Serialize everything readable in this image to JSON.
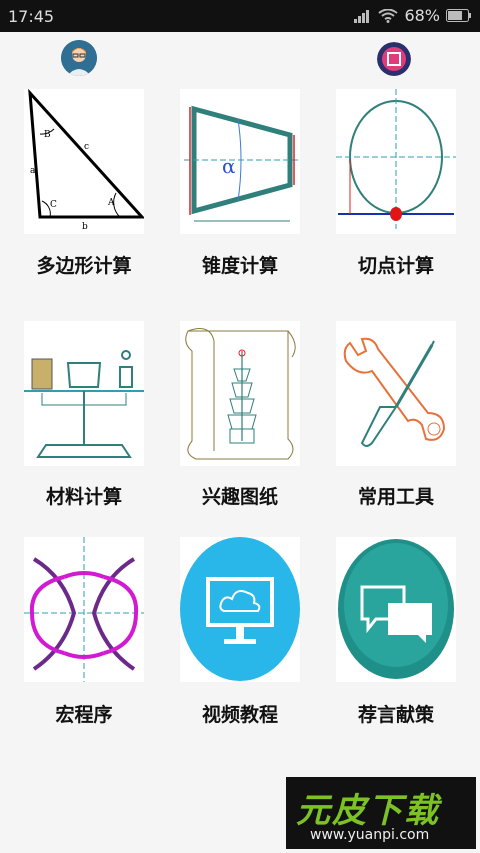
{
  "status": {
    "time": "17:45",
    "battery": "68%"
  },
  "avatars": {
    "left": "user-avatar",
    "right": "app-logo-avatar"
  },
  "grid": {
    "items": [
      {
        "label": "多边形计算",
        "icon": "triangle-diagram"
      },
      {
        "label": "锥度计算",
        "icon": "taper-diagram"
      },
      {
        "label": "切点计算",
        "icon": "tangent-circle-diagram"
      },
      {
        "label": "材料计算",
        "icon": "balance-scale-diagram"
      },
      {
        "label": "兴趣图纸",
        "icon": "pagoda-scroll-drawing"
      },
      {
        "label": "常用工具",
        "icon": "wrench-screwdriver-icon"
      },
      {
        "label": "宏程序",
        "icon": "macro-curves-diagram"
      },
      {
        "label": "视频教程",
        "icon": "monitor-cloud-icon"
      },
      {
        "label": "荐言献策",
        "icon": "chat-bubbles-icon"
      }
    ]
  },
  "watermark": {
    "brand": "元皮下载",
    "url": "www.yuanpi.com"
  },
  "colors": {
    "status_bg": "#111111",
    "page_bg": "#f5f5f5",
    "video_blue": "#29b6e8",
    "chat_teal": "#1f8f8a"
  }
}
